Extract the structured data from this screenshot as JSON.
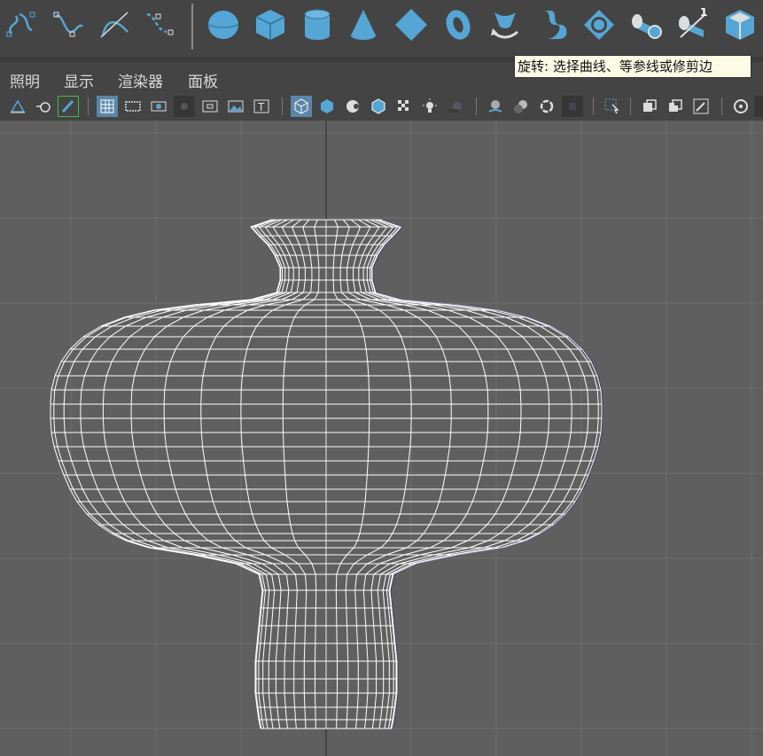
{
  "shelf": {
    "tools": [
      {
        "icon": "cv-curve-icon"
      },
      {
        "icon": "ep-curve-icon"
      },
      {
        "icon": "bezier-curve-icon"
      },
      {
        "icon": "pencil-curve-icon"
      },
      {
        "icon": "nurbs-sphere-icon"
      },
      {
        "icon": "nurbs-cube-icon"
      },
      {
        "icon": "nurbs-cylinder-icon"
      },
      {
        "icon": "nurbs-cone-icon"
      },
      {
        "icon": "nurbs-plane-icon"
      },
      {
        "icon": "nurbs-torus-icon"
      },
      {
        "icon": "revolve-icon"
      },
      {
        "icon": "loft-icon"
      },
      {
        "icon": "planar-icon"
      },
      {
        "icon": "extrude-icon"
      },
      {
        "icon": "birail-icon",
        "badge": "1"
      },
      {
        "icon": "bevel-icon"
      }
    ]
  },
  "tooltip": {
    "text": "旋转: 选择曲线、等参线或修剪边"
  },
  "menu": {
    "items": [
      "照明",
      "显示",
      "渲染器",
      "面板"
    ]
  },
  "accent_color": "#55a6d4",
  "wireframe_color": "#ffffff",
  "viewport_bg": "#5f5f5f"
}
